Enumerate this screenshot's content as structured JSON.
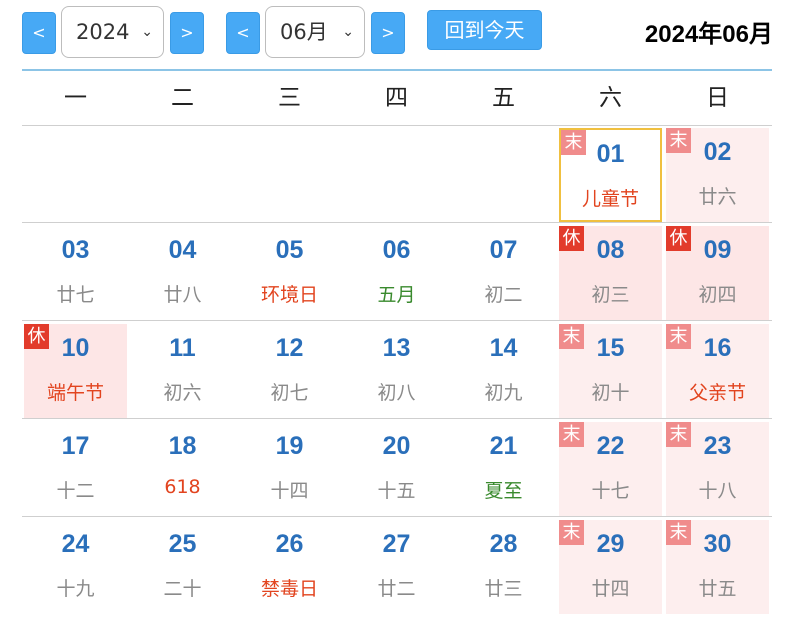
{
  "toolbar": {
    "prev_year": "<",
    "year_value": "2024",
    "next_year": ">",
    "prev_month": "<",
    "month_value": "06月",
    "next_month": ">",
    "today_label": "回到今天",
    "title": "2024年06月",
    "chevron": "⌄",
    "colors": {
      "button": "#47a9f5",
      "selected_border": "#f0c040",
      "rest_badge": "#e23b2b",
      "weekend_badge": "#f08c8c"
    }
  },
  "weekdays": [
    "一",
    "二",
    "三",
    "四",
    "五",
    "六",
    "日"
  ],
  "weeks": [
    [
      null,
      null,
      null,
      null,
      null,
      {
        "day": "01",
        "sub": "儿童节",
        "subStyle": "red",
        "badge": "末",
        "badgeType": "mo",
        "bg": "weekend",
        "selected": true
      },
      {
        "day": "02",
        "sub": "廿六",
        "subStyle": "gray",
        "badge": "末",
        "badgeType": "mo",
        "bg": "weekend"
      }
    ],
    [
      {
        "day": "03",
        "sub": "廿七",
        "subStyle": "gray"
      },
      {
        "day": "04",
        "sub": "廿八",
        "subStyle": "gray"
      },
      {
        "day": "05",
        "sub": "环境日",
        "subStyle": "red"
      },
      {
        "day": "06",
        "sub": "五月",
        "subStyle": "green"
      },
      {
        "day": "07",
        "sub": "初二",
        "subStyle": "gray"
      },
      {
        "day": "08",
        "sub": "初三",
        "subStyle": "gray",
        "badge": "休",
        "badgeType": "xiu",
        "bg": "holiday"
      },
      {
        "day": "09",
        "sub": "初四",
        "subStyle": "gray",
        "badge": "休",
        "badgeType": "xiu",
        "bg": "holiday"
      }
    ],
    [
      {
        "day": "10",
        "sub": "端午节",
        "subStyle": "red",
        "badge": "休",
        "badgeType": "xiu",
        "bg": "holiday"
      },
      {
        "day": "11",
        "sub": "初六",
        "subStyle": "gray"
      },
      {
        "day": "12",
        "sub": "初七",
        "subStyle": "gray"
      },
      {
        "day": "13",
        "sub": "初八",
        "subStyle": "gray"
      },
      {
        "day": "14",
        "sub": "初九",
        "subStyle": "gray"
      },
      {
        "day": "15",
        "sub": "初十",
        "subStyle": "gray",
        "badge": "末",
        "badgeType": "mo",
        "bg": "weekend"
      },
      {
        "day": "16",
        "sub": "父亲节",
        "subStyle": "red",
        "badge": "末",
        "badgeType": "mo",
        "bg": "weekend"
      }
    ],
    [
      {
        "day": "17",
        "sub": "十二",
        "subStyle": "gray"
      },
      {
        "day": "18",
        "sub": "618",
        "subStyle": "red"
      },
      {
        "day": "19",
        "sub": "十四",
        "subStyle": "gray"
      },
      {
        "day": "20",
        "sub": "十五",
        "subStyle": "gray"
      },
      {
        "day": "21",
        "sub": "夏至",
        "subStyle": "green"
      },
      {
        "day": "22",
        "sub": "十七",
        "subStyle": "gray",
        "badge": "末",
        "badgeType": "mo",
        "bg": "weekend"
      },
      {
        "day": "23",
        "sub": "十八",
        "subStyle": "gray",
        "badge": "末",
        "badgeType": "mo",
        "bg": "weekend"
      }
    ],
    [
      {
        "day": "24",
        "sub": "十九",
        "subStyle": "gray"
      },
      {
        "day": "25",
        "sub": "二十",
        "subStyle": "gray"
      },
      {
        "day": "26",
        "sub": "禁毒日",
        "subStyle": "red"
      },
      {
        "day": "27",
        "sub": "廿二",
        "subStyle": "gray"
      },
      {
        "day": "28",
        "sub": "廿三",
        "subStyle": "gray"
      },
      {
        "day": "29",
        "sub": "廿四",
        "subStyle": "gray",
        "badge": "末",
        "badgeType": "mo",
        "bg": "weekend"
      },
      {
        "day": "30",
        "sub": "廿五",
        "subStyle": "gray",
        "badge": "末",
        "badgeType": "mo",
        "bg": "weekend"
      }
    ]
  ]
}
